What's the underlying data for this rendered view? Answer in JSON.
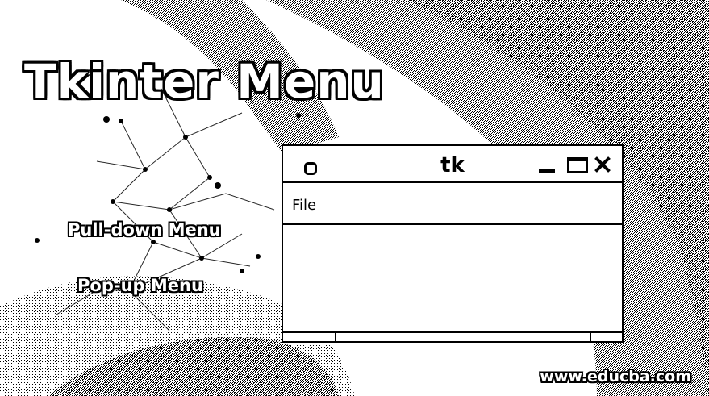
{
  "banner": {
    "title": "Tkinter Menu",
    "items": [
      "Pull-down Menu",
      "Pop-up Menu"
    ],
    "watermark": "www.educba.com"
  },
  "window": {
    "title": "tk",
    "menu": [
      "File"
    ],
    "controls": {
      "app_icon": "window-app-icon",
      "minimize": "minimize-icon",
      "maximize": "maximize-icon",
      "close": "close-icon"
    }
  },
  "colors": {
    "ink": "#000000",
    "paper": "#ffffff"
  }
}
